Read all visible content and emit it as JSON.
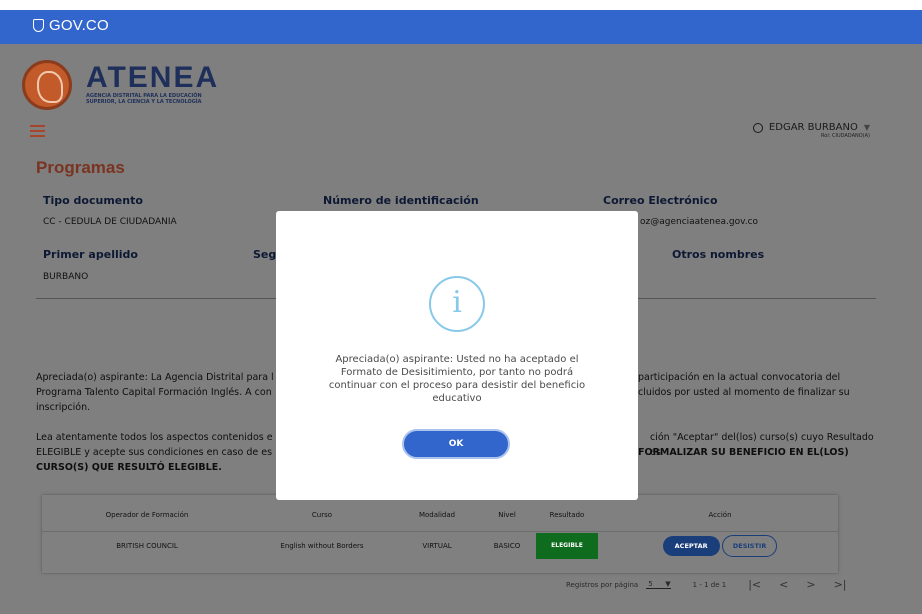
{
  "gov_bar": {
    "logo_text": "GOV.CO"
  },
  "brand": {
    "name": "ATENEA",
    "subtitle": "AGENCIA DISTRITAL PARA LA EDUCACIÓN SUPERIOR, LA CIENCIA Y LA TECNOLOGÍA"
  },
  "user": {
    "name": "EDGAR BURBANO",
    "role": "Rol: CIUDADANO(A)"
  },
  "page_title": "Programas",
  "fields": {
    "tipo_documento": {
      "label": "Tipo documento",
      "value": "CC - CEDULA DE CIUDADANIA"
    },
    "numero_identificacion": {
      "label": "Número de identificación"
    },
    "correo": {
      "label": "Correo Electrónico",
      "value_partial": "oz@agenciaatenea.gov.co"
    },
    "primer_apellido": {
      "label": "Primer apellido",
      "value": "BURBANO"
    },
    "segundo_partial": {
      "label": "Seg"
    },
    "otros_nombres": {
      "label": "Otros nombres"
    }
  },
  "paragraph1": {
    "left_line1": "Apreciada(o) aspirante: La Agencia Distrital para l",
    "left_line2": "Programa Talento Capital Formación Inglés. A con",
    "left_line3": "inscripción.",
    "right_line1": "participación en la actual convocatoria del",
    "right_line2": "cluidos por usted al momento de finalizar su"
  },
  "paragraph2": {
    "left_line1": "Lea atentamente todos los aspectos contenidos e",
    "left_line2": "ELEGIBLE y acepte sus condiciones en caso de es",
    "left_line3": "CURSO(S) QUE RESULTÓ ELEGIBLE.",
    "right_line1": "ción \"Aceptar\" del(los) curso(s) cuyo Resultado es",
    "right_line2": "FORMALIZAR SU BENEFICIO EN EL(LOS)"
  },
  "table": {
    "headers": [
      "Operador de Formación",
      "Curso",
      "Modalidad",
      "Nivel",
      "Resultado",
      "Acción"
    ],
    "rows": [
      {
        "operador": "BRITISH COUNCIL",
        "curso": "English without Borders",
        "modalidad": "VIRTUAL",
        "nivel": "BASICO",
        "resultado": "ELEGIBLE",
        "accept": "ACEPTAR",
        "desist": "DESISTIR"
      }
    ]
  },
  "pagination": {
    "label": "Registros por página",
    "per_page": "5",
    "range": "1 - 1 de 1"
  },
  "modal": {
    "icon": "i",
    "message": "Apreciada(o) aspirante: Usted no ha aceptado el Formato de Desisitimiento, por tanto no podrá continuar con el proceso para desistir del beneficio educativo",
    "ok_label": "OK"
  },
  "colors": {
    "gov_blue": "#3366cc",
    "title_red": "#a8442a",
    "navy": "#1d2f5a",
    "info_blue": "#86c9e8",
    "elegible_green": "#1db33a"
  }
}
